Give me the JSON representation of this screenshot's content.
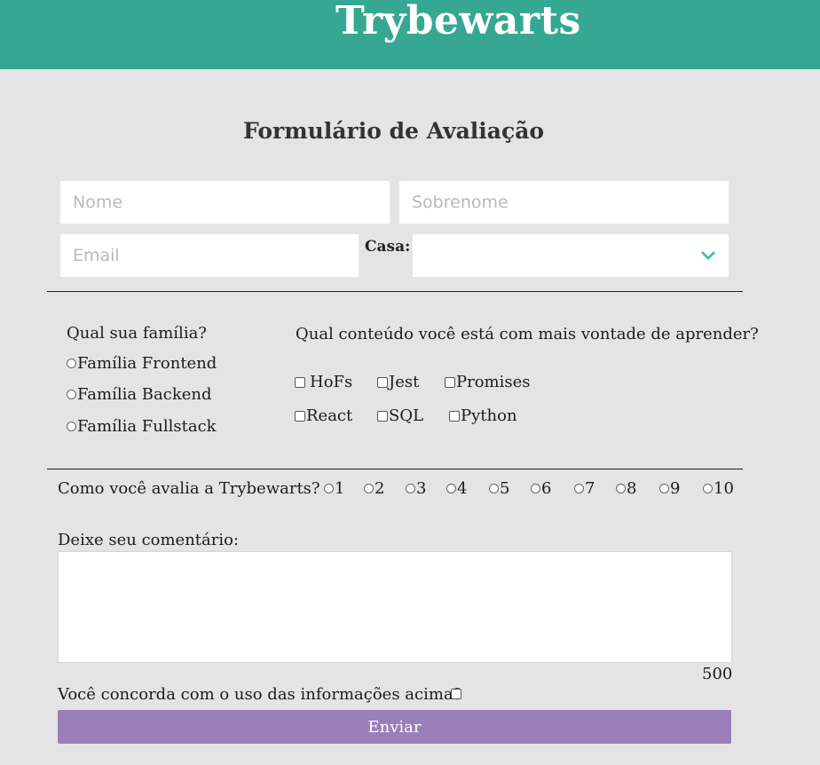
{
  "header": {
    "title": "Trybewarts",
    "bg_color": "#36a792"
  },
  "form": {
    "title": "Formulário de Avaliação",
    "nome_placeholder": "Nome",
    "sobrenome_placeholder": "Sobrenome",
    "email_placeholder": "Email",
    "casa_label": "Casa:",
    "casa_selected": ""
  },
  "familia": {
    "question": "Qual sua família?",
    "options": [
      "Família Frontend",
      "Família Backend",
      "Família Fullstack"
    ]
  },
  "conteudo": {
    "question": "Qual conteúdo você está com mais vontade de aprender?",
    "options": [
      "HoFs",
      "Jest",
      "Promises",
      "React",
      "SQL",
      "Python"
    ]
  },
  "rating": {
    "question": "Como você avalia a Trybewarts?",
    "options": [
      "1",
      "2",
      "3",
      "4",
      "5",
      "6",
      "7",
      "8",
      "9",
      "10"
    ]
  },
  "comment": {
    "label": "Deixe seu comentário:",
    "counter": "500"
  },
  "agreement": {
    "label": "Você concorda com o uso das informações acima?"
  },
  "submit": {
    "label": "Enviar",
    "color": "#9b7fb8"
  },
  "colors": {
    "accent": "#36a792",
    "background": "#e4e4e4",
    "chevron": "#2cc4a8"
  },
  "icons": {
    "select_arrow": "chevron-down-icon"
  }
}
